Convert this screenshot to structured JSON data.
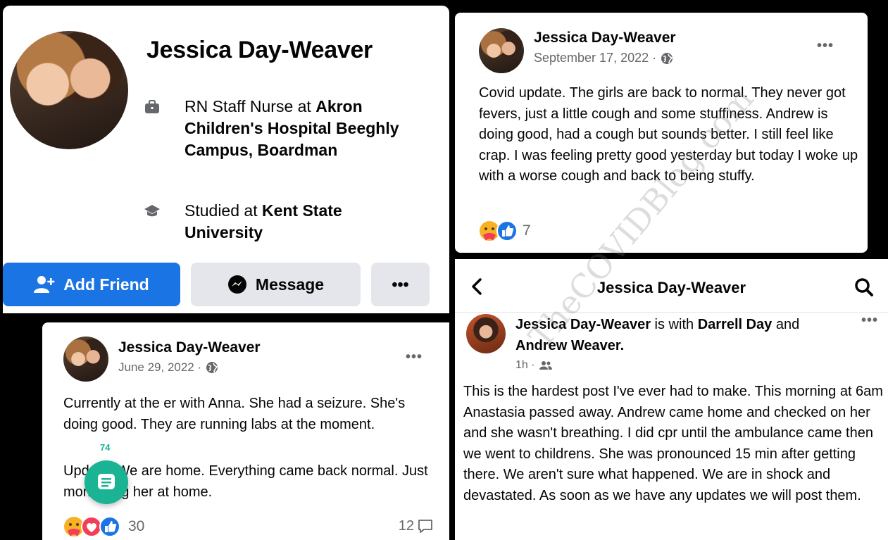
{
  "profile": {
    "name": "Jessica Day-Weaver",
    "work_prefix": "RN Staff Nurse at ",
    "work_place": "Akron Children's Hospital Beeghly Campus, Boardman",
    "edu_prefix": "Studied at ",
    "edu_place": "Kent State University",
    "buttons": {
      "add_friend": "Add Friend",
      "message": "Message",
      "more": "•••"
    },
    "colors": {
      "primary": "#1b74e4",
      "secondary_btn": "#e4e6eb"
    }
  },
  "post_sept": {
    "author": "Jessica Day-Weaver",
    "date": "September 17, 2022 ·",
    "more": "•••",
    "text": "Covid update.  The girls are back to normal.  They never got fevers, just a little cough and some stuffiness. Andrew is doing good, had a cough but sounds better. I still feel like crap. I was feeling pretty good yesterday but today I woke up with a worse cough and back to being stuffy.",
    "reaction_count": "7"
  },
  "post_june": {
    "author": "Jessica Day-Weaver",
    "date": "June 29, 2022 ·",
    "more": "•••",
    "text1": "Currently at the er with Anna. She had a seizure. She's doing good. They are running labs at the moment.",
    "text2": "Update: We are home. Everything came back normal. Just monitoring her at home.",
    "reaction_count": "30",
    "comment_count": "12"
  },
  "post_latest": {
    "header_title": "Jessica Day-Weaver",
    "author": "Jessica Day-Weaver",
    "with_text": " is with ",
    "tag1": "Darrell Day",
    "and_text": " and ",
    "tag2": "Andrew Weaver.",
    "time": "1h ·",
    "more": "•••",
    "text": "This is the hardest post I've ever had to make. This morning at 6am Anastasia passed away. Andrew came home and checked on her and she wasn't breathing.  I did cpr until the ambulance came then we went to childrens. She was pronounced 15 min after getting there. We aren't sure what happened. We are in shock and devastated.  As soon as we have any updates we will post them."
  },
  "watermark": "TheCOVIDBlog.com",
  "fab": {
    "count": "74",
    "color": "#1ab394"
  }
}
